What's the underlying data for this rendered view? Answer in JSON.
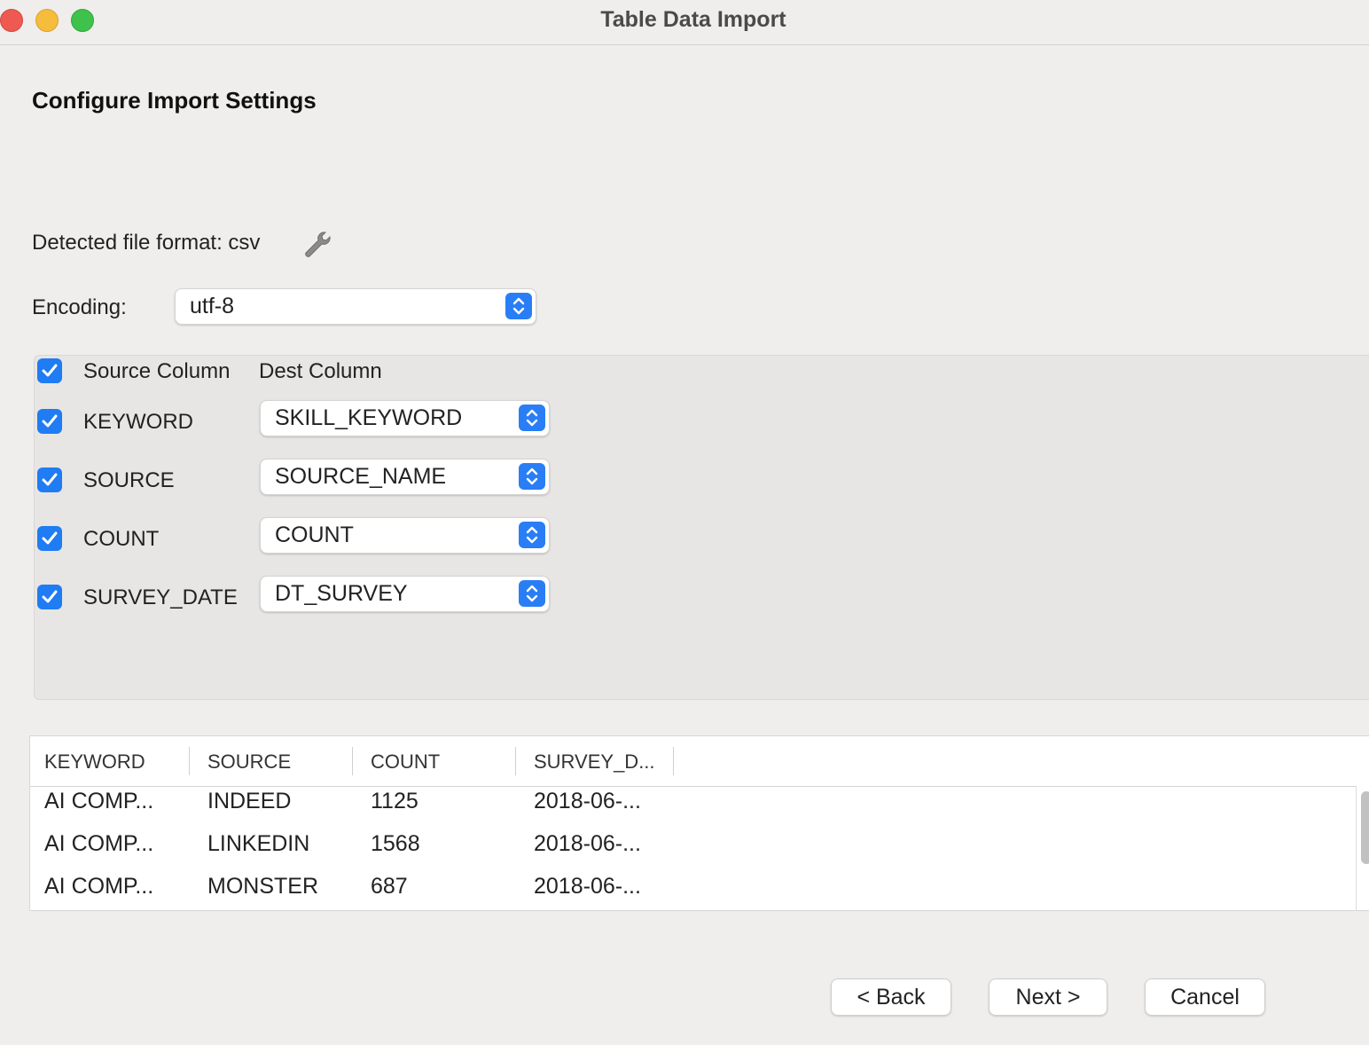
{
  "window": {
    "title": "Table Data Import"
  },
  "page": {
    "title": "Configure Import Settings"
  },
  "format": {
    "label": "Detected file format: csv"
  },
  "encoding": {
    "label": "Encoding:",
    "value": "utf-8"
  },
  "mapping": {
    "header": {
      "source": "Source Column",
      "dest": "Dest Column",
      "all_checked": true
    },
    "rows": [
      {
        "source": "KEYWORD",
        "dest": "SKILL_KEYWORD",
        "checked": true
      },
      {
        "source": "SOURCE",
        "dest": "SOURCE_NAME",
        "checked": true
      },
      {
        "source": "COUNT",
        "dest": "COUNT",
        "checked": true
      },
      {
        "source": "SURVEY_DATE",
        "dest": "DT_SURVEY",
        "checked": true
      }
    ]
  },
  "preview": {
    "columns": [
      "KEYWORD",
      "SOURCE",
      "COUNT",
      "SURVEY_D..."
    ],
    "rows": [
      [
        "AI COMP...",
        "INDEED",
        "1125",
        "2018-06-..."
      ],
      [
        "AI COMP...",
        "LINKEDIN",
        "1568",
        "2018-06-..."
      ],
      [
        "AI COMP...",
        "MONSTER",
        "687",
        "2018-06-..."
      ]
    ]
  },
  "buttons": {
    "back": "< Back",
    "next": "Next >",
    "cancel": "Cancel"
  },
  "colors": {
    "accent": "#1f7cf2",
    "close": "#ee5a51",
    "minimize": "#f6bc3c",
    "maximize": "#3fc24c"
  }
}
